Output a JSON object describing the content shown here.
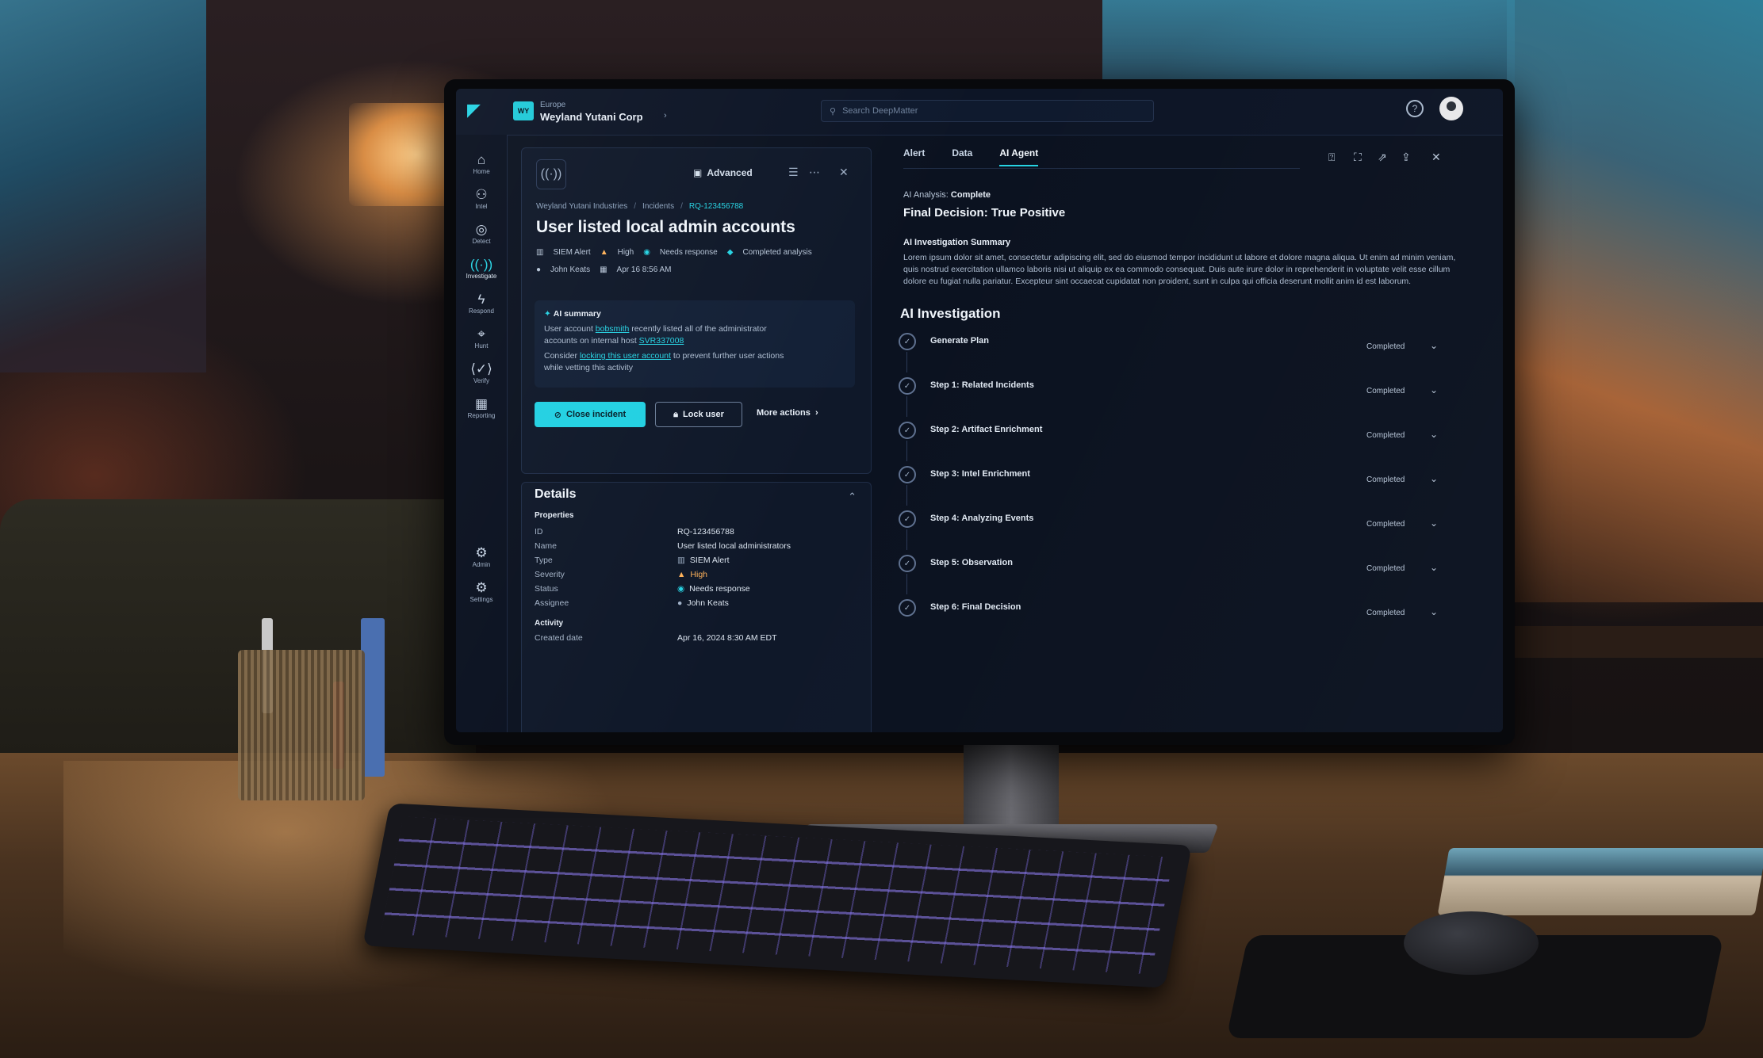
{
  "org": {
    "badge": "WY",
    "subtitle": "Europe",
    "name": "Weyland Yutani Corp",
    "chevron": "›"
  },
  "search": {
    "placeholder": "Search DeepMatter"
  },
  "topbar_icons": {
    "help": "help-circle-icon",
    "avatar": "user-avatar"
  },
  "nav": {
    "items": [
      {
        "label": "Home",
        "icon": "home-icon",
        "glyph": "⌂"
      },
      {
        "label": "Intel",
        "icon": "binoculars-icon",
        "glyph": "⚇"
      },
      {
        "label": "Detect",
        "icon": "radar-icon",
        "glyph": "◎"
      },
      {
        "label": "Investigate",
        "icon": "signal-icon",
        "glyph": "((·))"
      },
      {
        "label": "Respond",
        "icon": "bolt-icon",
        "glyph": "ϟ"
      },
      {
        "label": "Hunt",
        "icon": "target-icon",
        "glyph": "⌖"
      },
      {
        "label": "Verify",
        "icon": "check-bracket-icon",
        "glyph": "⟨✓⟩"
      },
      {
        "label": "Reporting",
        "icon": "report-icon",
        "glyph": "▦"
      },
      {
        "label": "Admin",
        "icon": "admin-icon",
        "glyph": "⚙"
      },
      {
        "label": "Settings",
        "icon": "settings-icon",
        "glyph": "⚙"
      }
    ],
    "active_index": 3
  },
  "incident": {
    "advanced_label": "Advanced",
    "breadcrumbs": [
      "Weyland Yutani Industries",
      "Incidents",
      "RQ-123456788"
    ],
    "title": "User listed local admin accounts",
    "meta1": [
      "SIEM Alert",
      "High",
      "Needs response",
      "Completed analysis"
    ],
    "meta2": [
      "John Keats",
      "Apr 16 8:56 AM"
    ],
    "ai_summary": {
      "header": "AI summary",
      "line1_pre": "User account ",
      "line1_link": "bobsmith",
      "line1_post": " recently listed all of the administrator",
      "line2_pre": "accounts on internal host ",
      "line2_link": "SVR337008",
      "line3_pre": "Consider ",
      "line3_link": "locking this user account",
      "line3_post": " to prevent further user actions",
      "line4": "while vetting this activity"
    },
    "actions": {
      "primary": "Close incident",
      "secondary": "Lock user",
      "more": "More actions"
    }
  },
  "details": {
    "title": "Details",
    "properties_label": "Properties",
    "rows": [
      {
        "key": "ID",
        "value": "RQ-123456788"
      },
      {
        "key": "Name",
        "value": "User listed local administrators"
      },
      {
        "key": "Type",
        "value": "SIEM Alert"
      },
      {
        "key": "Severity",
        "value": "High"
      },
      {
        "key": "Status",
        "value": "Needs response"
      },
      {
        "key": "Assignee",
        "value": "John Keats"
      }
    ],
    "activity_label": "Activity",
    "activity_rows": [
      {
        "key": "Created date",
        "value": "Apr 16, 2024 8:30 AM EDT"
      }
    ]
  },
  "agent": {
    "tabs": [
      "Alert",
      "Data",
      "AI Agent"
    ],
    "active_tab": 2,
    "analysis_label": "AI Analysis:",
    "analysis_value": "Complete",
    "final_decision": "Final Decision: True Positive",
    "summary_title": "AI Investigation Summary",
    "summary_body": "Lorem ipsum dolor sit amet, consectetur adipiscing elit, sed do eiusmod tempor incididunt ut labore et dolore magna aliqua. Ut enim ad minim veniam, quis nostrud exercitation ullamco laboris nisi ut aliquip ex ea commodo consequat. Duis aute irure dolor in reprehenderit in voluptate velit esse cillum dolore eu fugiat nulla pariatur. Excepteur sint occaecat cupidatat non proident, sunt in culpa qui officia deserunt mollit anim id est laborum.",
    "investigation_title": "AI Investigation",
    "steps": [
      {
        "label": "Generate Plan",
        "status": "Completed"
      },
      {
        "label": "Step 1: Related Incidents",
        "status": "Completed"
      },
      {
        "label": "Step 2: Artifact Enrichment",
        "status": "Completed"
      },
      {
        "label": "Step 3: Intel Enrichment",
        "status": "Completed"
      },
      {
        "label": "Step 4: Analyzing Events",
        "status": "Completed"
      },
      {
        "label": "Step 5: Observation",
        "status": "Completed"
      },
      {
        "label": "Step 6: Final Decision",
        "status": "Completed"
      }
    ]
  },
  "colors": {
    "accent": "#27d3e3",
    "background": "#0b1220",
    "panel": "#0f1829",
    "severity_high": "#ffb25a"
  }
}
